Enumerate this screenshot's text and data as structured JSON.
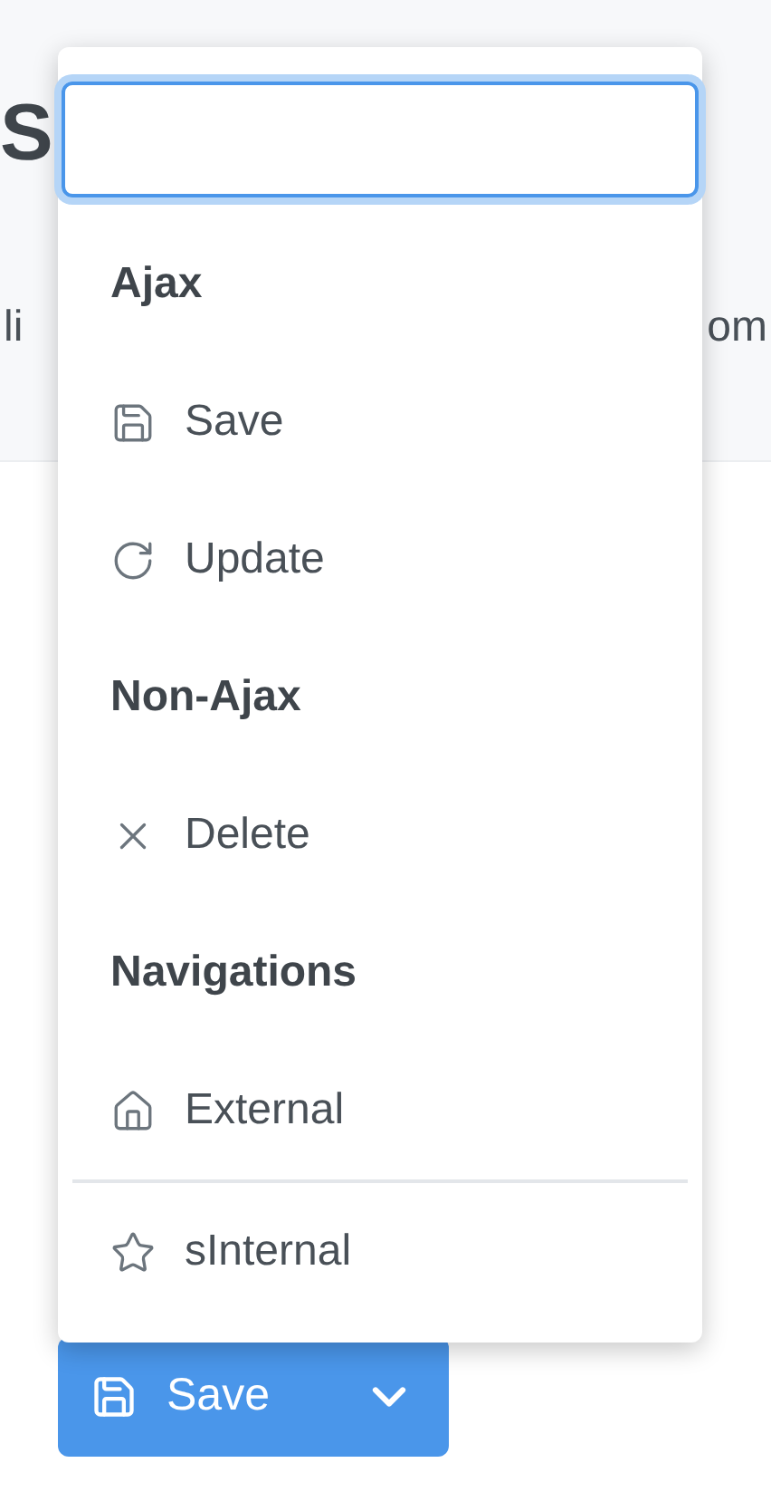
{
  "page": {
    "title": "S",
    "subtitle_left": "li",
    "subtitle_right": "om"
  },
  "menu": {
    "entries": [
      {
        "kind": "header",
        "label": "Ajax"
      },
      {
        "kind": "item",
        "label": "Save"
      },
      {
        "kind": "item",
        "label": "Update"
      },
      {
        "kind": "header",
        "label": "Non-Ajax"
      },
      {
        "kind": "item",
        "label": "Delete"
      },
      {
        "kind": "header",
        "label": "Navigations"
      },
      {
        "kind": "item",
        "label": "External"
      },
      {
        "kind": "divider"
      },
      {
        "kind": "item",
        "label": "sInternal"
      }
    ]
  },
  "button": {
    "label": "Save",
    "expanded": true
  }
}
